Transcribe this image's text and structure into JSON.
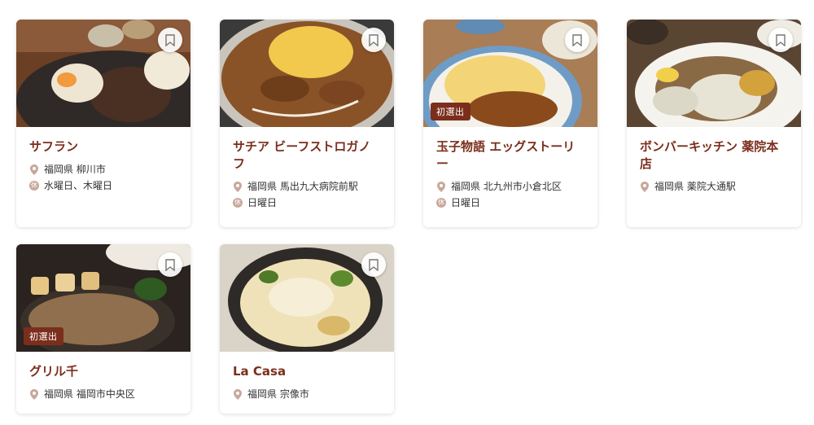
{
  "cards": [
    {
      "name": "サフラン",
      "location": "福岡県 柳川市",
      "holiday": "水曜日、木曜日",
      "badge": "",
      "photo_colors": [
        "#7a4a2a",
        "#2f2a28",
        "#e8d7b5"
      ]
    },
    {
      "name": "サチア ビーフストロガノフ",
      "location": "福岡県 馬出九大病院前駅",
      "holiday": "日曜日",
      "badge": "",
      "photo_colors": [
        "#8a5327",
        "#f2c94c",
        "#3b3a3a"
      ]
    },
    {
      "name": "玉子物語 エッグストーリー",
      "location": "福岡県 北九州市小倉北区",
      "holiday": "日曜日",
      "badge": "初選出",
      "photo_colors": [
        "#6f9cc6",
        "#f3d577",
        "#8a4a1c"
      ]
    },
    {
      "name": "ボンバーキッチン 薬院本店",
      "location": "福岡県 薬院大通駅",
      "holiday": "",
      "badge": "",
      "photo_colors": [
        "#5a4533",
        "#e8e4d5",
        "#d3a23c"
      ]
    },
    {
      "name": "グリル千",
      "location": "福岡県 福岡市中央区",
      "holiday": "",
      "badge": "初選出",
      "photo_colors": [
        "#2a2320",
        "#8f6f4e",
        "#e6c585"
      ]
    },
    {
      "name": "La Casa",
      "location": "福岡県 宗像市",
      "holiday": "",
      "badge": "",
      "photo_colors": [
        "#d9d3c8",
        "#2e2a27",
        "#f0e2b8"
      ]
    }
  ],
  "holiday_icon_char": "休",
  "colors": {
    "accent": "#7b2e1c",
    "badge_bg": "#7b2e1c",
    "pin": "#c9a79a"
  }
}
